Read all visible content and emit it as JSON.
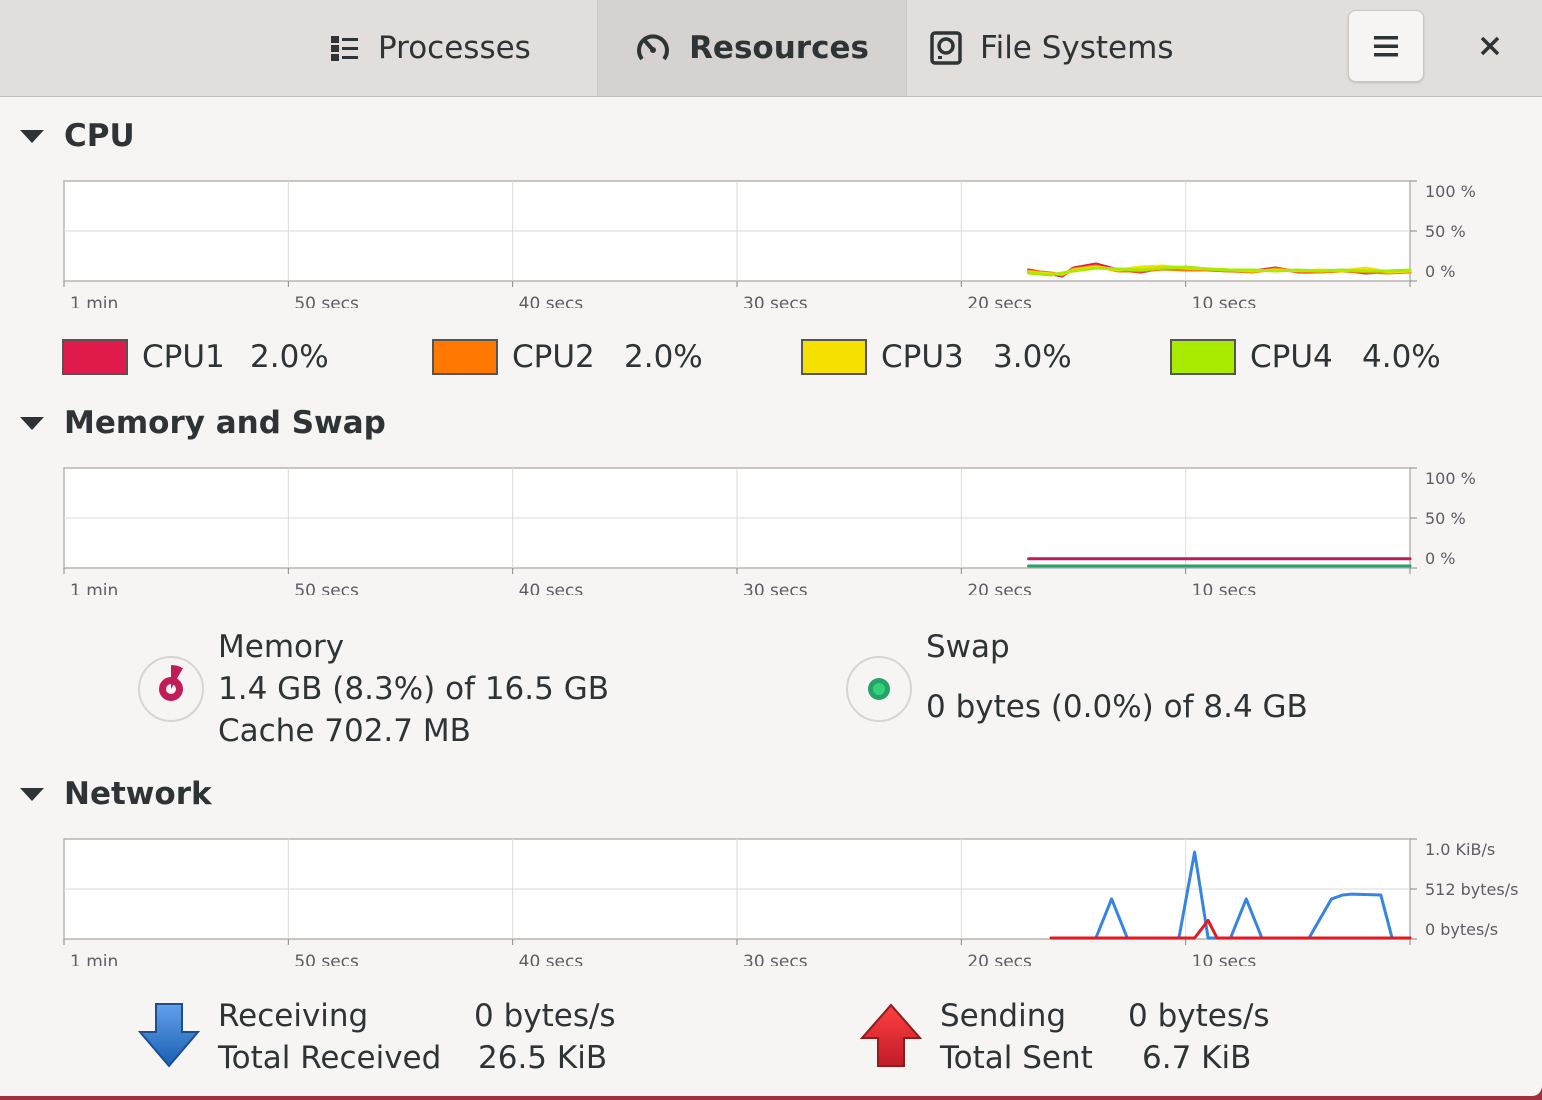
{
  "tabs": [
    {
      "label": "Processes",
      "icon": "list-icon"
    },
    {
      "label": "Resources",
      "icon": "gauge-icon"
    },
    {
      "label": "File Systems",
      "icon": "disk-icon"
    }
  ],
  "cpu": {
    "title": "CPU",
    "y_ticks": [
      "100 %",
      "50 %",
      "0 %"
    ],
    "x_ticks": [
      "1 min",
      "50 secs",
      "40 secs",
      "30 secs",
      "20 secs",
      "10 secs"
    ],
    "legend": [
      {
        "name": "CPU1",
        "value": "2.0%",
        "color": "#e01b4c"
      },
      {
        "name": "CPU2",
        "value": "2.0%",
        "color": "#ff7800"
      },
      {
        "name": "CPU3",
        "value": "3.0%",
        "color": "#f6e000"
      },
      {
        "name": "CPU4",
        "value": "4.0%",
        "color": "#a8ea00"
      }
    ]
  },
  "memory": {
    "title": "Memory and Swap",
    "y_ticks": [
      "100 %",
      "50 %",
      "0 %"
    ],
    "x_ticks": [
      "1 min",
      "50 secs",
      "40 secs",
      "30 secs",
      "20 secs",
      "10 secs"
    ],
    "memory_label": "Memory",
    "memory_used": "1.4 GB (8.3%) of 16.5 GB",
    "memory_cache": "Cache 702.7 MB",
    "memory_color": "#c01c5a",
    "memory_fraction": 0.083,
    "swap_label": "Swap",
    "swap_used": "0 bytes (0.0%) of 8.4 GB",
    "swap_color": "#26a269",
    "swap_fraction": 0.0
  },
  "network": {
    "title": "Network",
    "y_ticks": [
      "1.0 KiB/s",
      "512 bytes/s",
      "0 bytes/s"
    ],
    "x_ticks": [
      "1 min",
      "50 secs",
      "40 secs",
      "30 secs",
      "20 secs",
      "10 secs"
    ],
    "receiving_label": "Receiving",
    "receiving_value": "0 bytes/s",
    "total_received_label": "Total Received",
    "total_received_value": "26.5 KiB",
    "sending_label": "Sending",
    "sending_value": "0 bytes/s",
    "total_sent_label": "Total Sent",
    "total_sent_value": "6.7 KiB",
    "receiving_color": "#3584e4",
    "sending_color": "#e01b24"
  },
  "chart_data": [
    {
      "type": "line",
      "ylim": [
        0,
        100
      ],
      "xlim": [
        60,
        0
      ],
      "series": [
        {
          "name": "CPU1",
          "color": "#e01b4c",
          "x": [
            17,
            16,
            15.5,
            15,
            14,
            13,
            12,
            11,
            10,
            9,
            8,
            7,
            6,
            5,
            4,
            3,
            2,
            1,
            0
          ],
          "y": [
            10,
            6,
            4,
            12,
            16,
            10,
            8,
            12,
            11,
            10,
            9,
            9,
            12,
            8,
            8,
            10,
            7,
            8,
            8
          ]
        },
        {
          "name": "CPU2",
          "color": "#ff7800",
          "x": [
            17,
            16,
            15.5,
            15,
            14,
            13,
            12,
            11,
            10,
            9,
            8,
            7,
            6,
            5,
            4,
            3,
            2,
            1,
            0
          ],
          "y": [
            9,
            7,
            5,
            11,
            14,
            9,
            9,
            11,
            10,
            10,
            9,
            8,
            11,
            9,
            8,
            9,
            8,
            7,
            8
          ]
        },
        {
          "name": "CPU3",
          "color": "#f6e000",
          "x": [
            17,
            16,
            15.5,
            15,
            14,
            13,
            12,
            11,
            10,
            9,
            8,
            7,
            6,
            5,
            4,
            3,
            2,
            1,
            0
          ],
          "y": [
            8,
            6,
            6,
            10,
            13,
            10,
            13,
            14,
            12,
            11,
            10,
            9,
            10,
            9,
            10,
            9,
            12,
            8,
            9
          ]
        },
        {
          "name": "CPU4",
          "color": "#a8ea00",
          "x": [
            17,
            16,
            15.5,
            15,
            14,
            13,
            12,
            11,
            10,
            9,
            8,
            7,
            6,
            5,
            4,
            3,
            2,
            1,
            0
          ],
          "y": [
            7,
            5,
            7,
            9,
            12,
            11,
            10,
            12,
            13,
            11,
            10,
            10,
            9,
            10,
            9,
            10,
            9,
            9,
            10
          ]
        }
      ]
    },
    {
      "type": "line",
      "ylim": [
        0,
        100
      ],
      "xlim": [
        60,
        0
      ],
      "series": [
        {
          "name": "Memory",
          "color": "#c01c5a",
          "x": [
            17,
            0
          ],
          "y": [
            8.3,
            8.3
          ]
        },
        {
          "name": "Swap",
          "color": "#26a269",
          "x": [
            17,
            0
          ],
          "y": [
            1,
            1
          ]
        }
      ]
    },
    {
      "type": "line",
      "ylim": [
        0,
        1024
      ],
      "xlim": [
        60,
        0
      ],
      "series": [
        {
          "name": "Receiving",
          "color": "#3584e4",
          "x": [
            16,
            14.5,
            14,
            13.3,
            12.6,
            12,
            11,
            10.3,
            9.6,
            9,
            8.6,
            8,
            7.3,
            6.6,
            6,
            5.2,
            4.5,
            3.5,
            3,
            2.6,
            1.3,
            0.8,
            0.3,
            0
          ],
          "y": [
            0,
            0,
            0,
            400,
            0,
            0,
            0,
            0,
            880,
            0,
            0,
            0,
            400,
            0,
            0,
            0,
            0,
            400,
            440,
            450,
            440,
            0,
            0,
            0
          ]
        },
        {
          "name": "Sending",
          "color": "#e01b24",
          "x": [
            16,
            10,
            9.6,
            9,
            8.6,
            8,
            0
          ],
          "y": [
            0,
            0,
            0,
            180,
            0,
            0,
            0
          ]
        }
      ]
    }
  ]
}
